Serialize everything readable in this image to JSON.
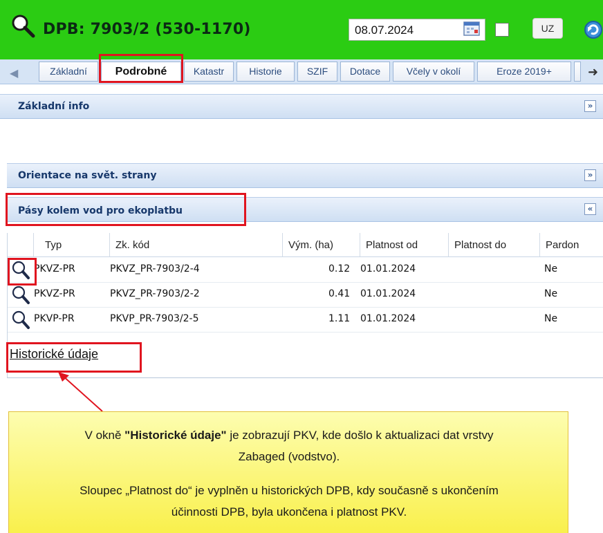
{
  "header": {
    "title": "DPB: 7903/2 (530-1170)",
    "date": "08.07.2024",
    "uz_label": "UZ",
    "search_icon": "magnifier-icon",
    "calendar_icon": "calendar-icon",
    "refresh_icon": "refresh-icon"
  },
  "tabs": [
    "Základní",
    "Podrobné",
    "Katastr",
    "Historie",
    "SZIF",
    "Dotace",
    "Včely v okolí",
    "Eroze 2019+"
  ],
  "active_tab": "Podrobné",
  "sections": {
    "zakladni": "Základní info",
    "orientace": "Orientace na svět. strany",
    "pasy": "Pásy kolem vod pro ekoplatbu"
  },
  "table": {
    "columns": [
      "Typ",
      "Zk. kód",
      "Vým. (ha)",
      "Platnost od",
      "Platnost do",
      "Pardon"
    ],
    "rows": [
      {
        "typ": "PKVZ-PR",
        "kod": "PKVZ_PR-7903/2-4",
        "vym": "0.12",
        "od": "01.01.2024",
        "do": "",
        "pardon": "Ne"
      },
      {
        "typ": "PKVZ-PR",
        "kod": "PKVZ_PR-7903/2-2",
        "vym": "0.41",
        "od": "01.01.2024",
        "do": "",
        "pardon": "Ne"
      },
      {
        "typ": "PKVP-PR",
        "kod": "PKVP_PR-7903/2-5",
        "vym": "1.11",
        "od": "01.01.2024",
        "do": "",
        "pardon": "Ne"
      }
    ]
  },
  "history_link": "Historické údaje",
  "callout": {
    "line1_pre": "V okně ",
    "line1_bold": "\"Historické údaje\"",
    "line1_post": " je zobrazují PKV, kde došlo k aktualizaci dat vrstvy",
    "line2": "Zabaged (vodstvo).",
    "line3": "Sloupec „Platnost do“ je vyplněn u historických DPB, kdy současně s ukončením",
    "line4": "účinnosti DPB, byla ukončena i platnost PKV."
  },
  "colors": {
    "header_bg": "#2bcc13",
    "highlight": "#e0141f",
    "callout_bg": "#f9f04c",
    "section_text": "#17386b"
  }
}
